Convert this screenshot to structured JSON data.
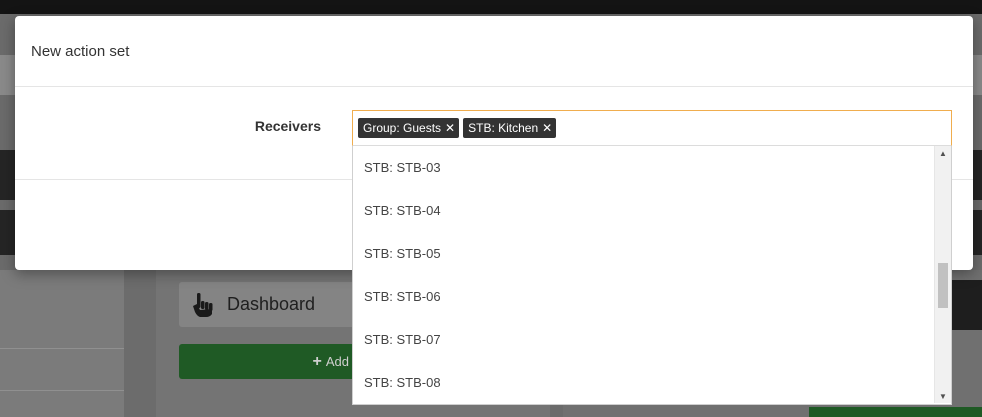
{
  "modal": {
    "title": "New action set"
  },
  "form": {
    "receivers_label": "Receivers",
    "selected_tags": [
      {
        "label": "Group: Guests",
        "remove_symbol": "✕"
      },
      {
        "label": "STB: Kitchen",
        "remove_symbol": "✕"
      }
    ],
    "search_value": ""
  },
  "dropdown": {
    "options": [
      "STB: STB-03",
      "STB: STB-04",
      "STB: STB-05",
      "STB: STB-06",
      "STB: STB-07",
      "STB: STB-08"
    ],
    "scroll_up_icon": "▲",
    "scroll_down_icon": "▼"
  },
  "background": {
    "dashboard_label": "Dashboard",
    "dashboard_icon": "pointing-hand-icon",
    "add_button_label": "Add",
    "add_button_icon": "+"
  },
  "colors": {
    "tag_background": "#333333",
    "focus_border": "#f0ad4e",
    "add_button_green": "#1f5a25"
  }
}
